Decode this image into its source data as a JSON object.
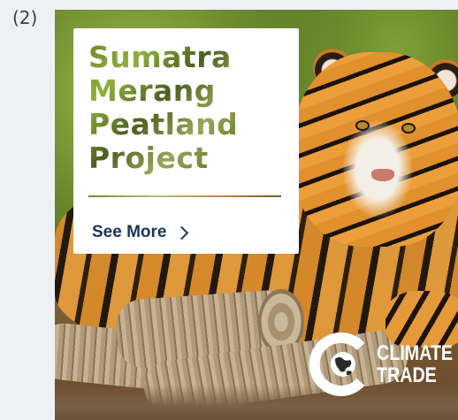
{
  "index_label": "(2)",
  "card": {
    "title": "Sumatra\nMerang\nPeatland\nProject",
    "cta_label": "See More"
  },
  "logo": {
    "line1": "CLIMATE",
    "line2": "TRADE"
  },
  "colors": {
    "cta_text": "#17365d",
    "title_green": "#6f8a2a",
    "page_bg": "#eef1f4"
  }
}
